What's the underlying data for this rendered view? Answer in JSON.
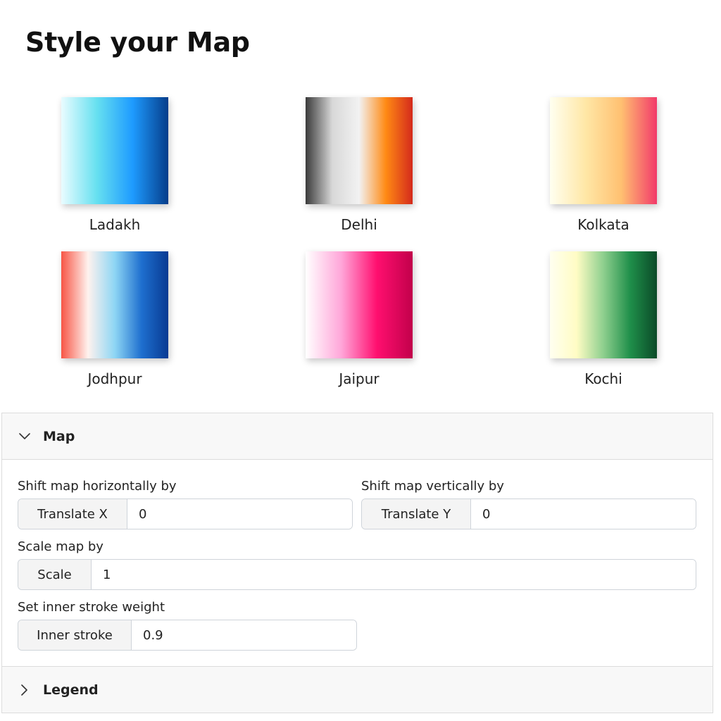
{
  "page": {
    "title": "Style your Map"
  },
  "palettes": [
    {
      "name": "Ladakh",
      "colors": [
        "#e9fcff",
        "#66e0f0",
        "#1e9bff",
        "#063d8a"
      ]
    },
    {
      "name": "Delhi",
      "colors": [
        "#3a3a3a",
        "#d8d8d8",
        "#f2f2f2",
        "#ff8a14",
        "#d42a1c"
      ]
    },
    {
      "name": "Kolkata",
      "colors": [
        "#fffff0",
        "#ffe7a6",
        "#ffc071",
        "#f23a6a"
      ]
    },
    {
      "name": "Jodhpur",
      "colors": [
        "#f75545",
        "#fff2ee",
        "#8ed6f4",
        "#1e6fcf",
        "#083a92"
      ]
    },
    {
      "name": "Jaipur",
      "colors": [
        "#ffffff",
        "#ffa6d9",
        "#ff0f6f",
        "#c2004b"
      ]
    },
    {
      "name": "Kochi",
      "colors": [
        "#fffff0",
        "#fffcc4",
        "#8ecf8e",
        "#1f8f4a",
        "#0b4a28"
      ]
    }
  ],
  "sections": {
    "map": {
      "title": "Map",
      "expanded": true,
      "shift_x": {
        "label": "Shift map horizontally by",
        "addon": "Translate X",
        "value": "0"
      },
      "shift_y": {
        "label": "Shift map vertically by",
        "addon": "Translate Y",
        "value": "0"
      },
      "scale": {
        "label": "Scale map by",
        "addon": "Scale",
        "value": "1"
      },
      "stroke": {
        "label": "Set inner stroke weight",
        "addon": "Inner stroke",
        "value": "0.9"
      }
    },
    "legend": {
      "title": "Legend",
      "expanded": false
    }
  }
}
